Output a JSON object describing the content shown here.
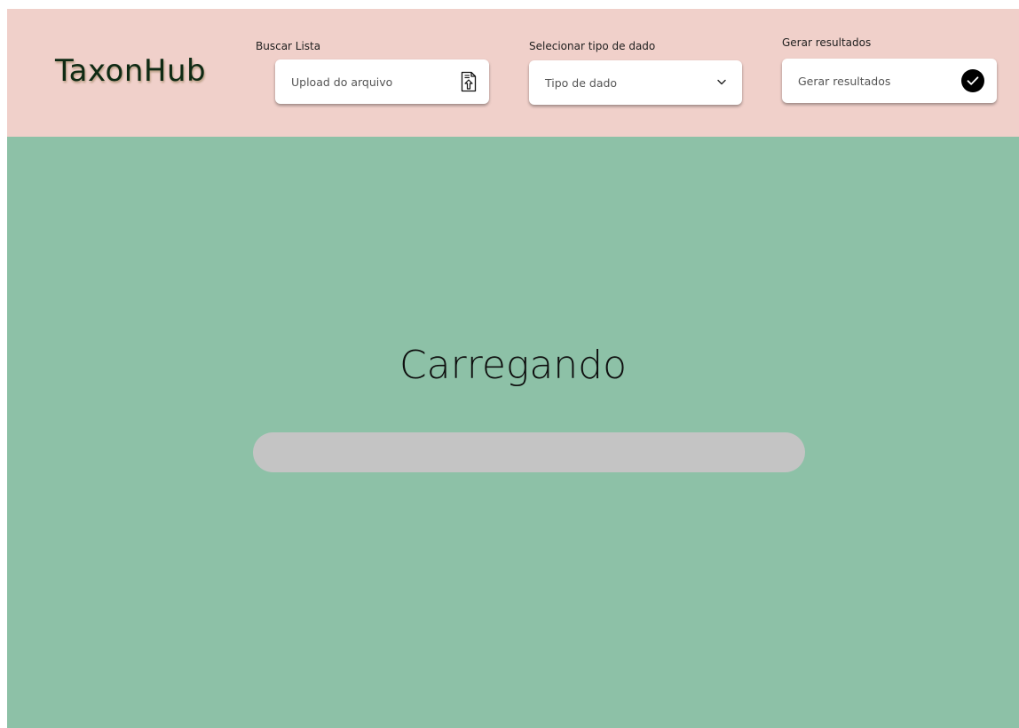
{
  "app": {
    "brand": "TaxonHub"
  },
  "header": {
    "buscar_lista": {
      "label": "Buscar Lista",
      "placeholder": "Upload do arquivo",
      "icon": "file-upload-icon"
    },
    "tipo_dado": {
      "label": "Selecionar tipo de dado",
      "placeholder": "Tipo de dado",
      "icon": "chevron-down-icon"
    },
    "gerar_resultados": {
      "label": "Gerar resultados",
      "placeholder": "Gerar resultados",
      "icon": "check-circle-icon"
    }
  },
  "main": {
    "status_text": "Carregando",
    "progress_fraction": 0
  },
  "colors": {
    "header_bg": "#f0d0ca",
    "main_bg": "#8dc1a7",
    "progress_track": "#c4c4c4",
    "brand_text": "#0f2a14"
  }
}
